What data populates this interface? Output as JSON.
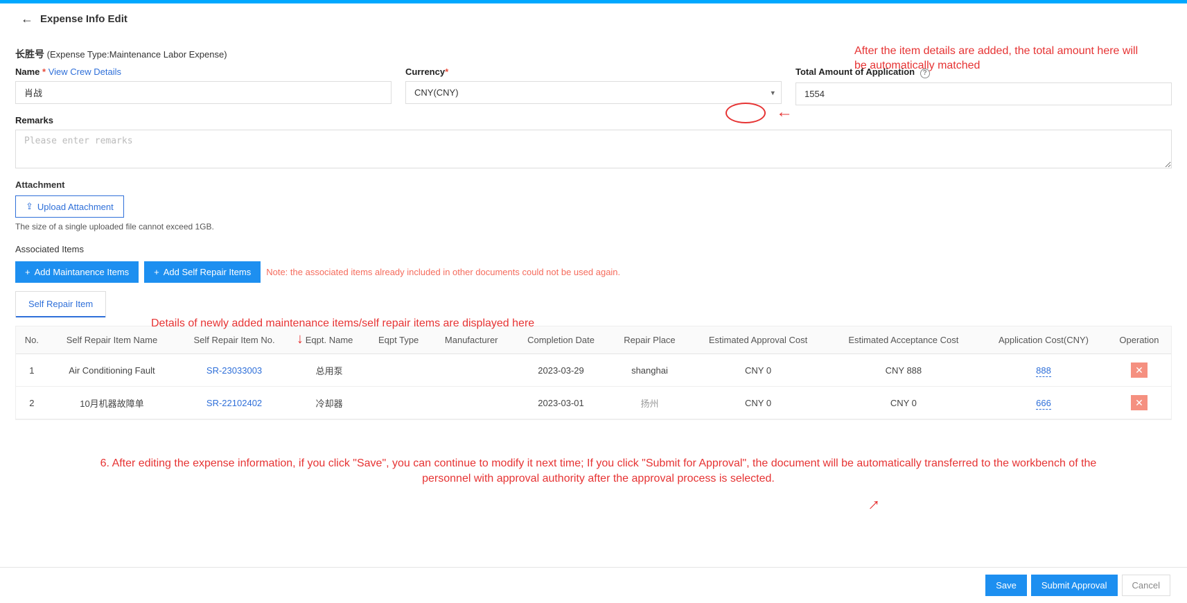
{
  "page": {
    "title": "Expense Info Edit",
    "entity": "长胜号",
    "subtitle": "(Expense Type:Maintenance Labor Expense)"
  },
  "form": {
    "name_label": "Name",
    "view_crew": "View Crew Details",
    "name_value": "肖战",
    "currency_label": "Currency",
    "currency_value": "CNY(CNY)",
    "total_label": "Total Amount of Application",
    "total_value": "1554",
    "remarks_label": "Remarks",
    "remarks_placeholder": "Please enter remarks"
  },
  "attachment": {
    "heading": "Attachment",
    "upload_label": "Upload Attachment",
    "hint": "The size of a single uploaded file cannot exceed 1GB."
  },
  "assoc": {
    "heading": "Associated Items",
    "add_maint": "Add Maintanence Items",
    "add_self": "Add Self Repair Items",
    "note": "Note: the associated items already included in other documents could not be used again."
  },
  "tabs": {
    "self_repair": "Self Repair Item"
  },
  "table": {
    "headers": {
      "no": "No.",
      "name": "Self Repair Item Name",
      "itemno": "Self Repair Item No.",
      "eqpt": "Eqpt. Name",
      "eqpttype": "Eqpt Type",
      "mfr": "Manufacturer",
      "compdate": "Completion Date",
      "place": "Repair Place",
      "estapp": "Estimated Approval Cost",
      "estacc": "Estimated Acceptance Cost",
      "appcost": "Application Cost(CNY)",
      "op": "Operation"
    },
    "rows": [
      {
        "no": "1",
        "name": "Air Conditioning Fault",
        "itemno": "SR-23033003",
        "eqpt": "总用泵",
        "eqpttype": "",
        "mfr": "",
        "compdate": "2023-03-29",
        "place": "shanghai",
        "estapp": "CNY 0",
        "estacc": "CNY 888",
        "appcost": "888"
      },
      {
        "no": "2",
        "name": "10月机器故障单",
        "itemno": "SR-22102402",
        "eqpt": "冷却器",
        "eqpttype": "",
        "mfr": "",
        "compdate": "2023-03-01",
        "place": "扬州",
        "estapp": "CNY 0",
        "estacc": "CNY 0",
        "appcost": "666"
      }
    ]
  },
  "annotations": {
    "top": "After the item details are added, the total amount here will be automatically matched",
    "mid": "Details of newly added maintenance items/self repair items are displayed here",
    "bottom": "6. After editing the expense information, if you click \"Save\", you can continue to modify it next time; If you click \"Submit for Approval\", the document will be automatically transferred to the workbench of the personnel with approval authority after the approval process is selected."
  },
  "footer": {
    "save": "Save",
    "submit": "Submit Approval",
    "cancel": "Cancel"
  }
}
